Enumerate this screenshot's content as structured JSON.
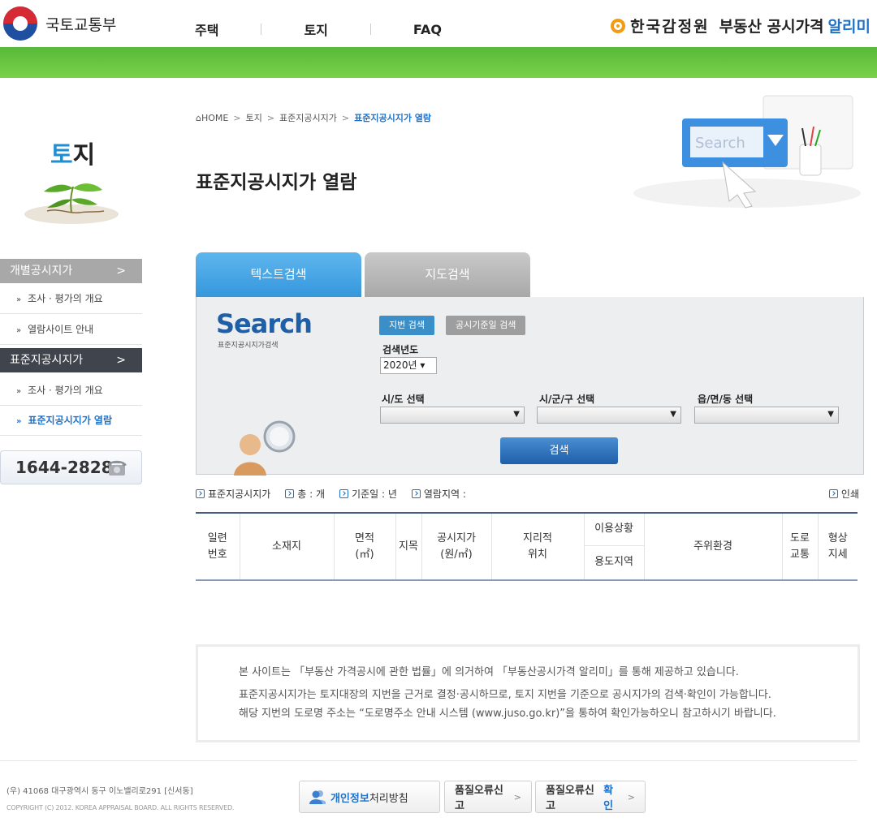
{
  "header": {
    "gov_name": "국토교통부",
    "nav": [
      "주택",
      "토지",
      "FAQ"
    ],
    "kab_name": "한국감정원",
    "service_name": "부동산 공시가격",
    "service_accent": "알리미"
  },
  "sidebar": {
    "title_accent": "토",
    "title_rest": "지",
    "cat1": "개별공시지가",
    "cat1_arrow": ">",
    "cat1_items": [
      "조사 · 평가의 개요",
      "열람사이트 안내"
    ],
    "cat2": "표준지공시지가",
    "cat2_arrow": ">",
    "cat2_items": [
      "조사 · 평가의 개요",
      "표준지공시지가 열람"
    ],
    "bullet": "»",
    "phone": "1644-2828"
  },
  "breadcrumb": {
    "home": "HOME",
    "items": [
      "토지",
      "표준지공시지가"
    ],
    "current": "표준지공시지가 열람",
    "sep": ">"
  },
  "page_title": "표준지공시지가 열람",
  "tabs": [
    "텍스트검색",
    "지도검색"
  ],
  "search": {
    "logo": "Search",
    "logo_sub": "표준지공시지가검색",
    "btn_lot": "지번 검색",
    "btn_date": "공시기준일 검색",
    "year_label": "검색년도",
    "year_value": "2020년 ▾",
    "sido_label": "시/도 선택",
    "sigungu_label": "시/군/구 선택",
    "eupmyeondong_label": "읍/면/동 선택",
    "caret": "▼",
    "submit": "검색"
  },
  "info": {
    "items": [
      "표준지공시지가",
      "총 : 개",
      "기준일 : 년",
      "열람지역 :"
    ],
    "print": "인쇄"
  },
  "table": {
    "col_no": [
      "일련",
      "번호"
    ],
    "col_addr": "소재지",
    "col_area": [
      "면적",
      "(㎡)"
    ],
    "col_jimok": "지목",
    "col_price": [
      "공시지가",
      "(원/㎡)"
    ],
    "col_geo": [
      "지리적",
      "위치"
    ],
    "col_use": "이용상황",
    "col_zone": "용도지역",
    "col_env": "주위환경",
    "col_road": [
      "도로",
      "교통"
    ],
    "col_shape": [
      "형상",
      "지세"
    ]
  },
  "notice": {
    "line1": "본 사이트는 「부동산 가격공시에 관한 법률」에 의거하여 「부동산공시가격 알리미」를 통해 제공하고 있습니다.",
    "line2": "표준지공시지가는 토지대장의 지번을 근거로 결정·공시하므로, 토지 지번을 기준으로 공시지가의 검색·확인이 가능합니다.",
    "line3": "해당 지번의 도로명 주소는 “도로명주소 안내 시스템 (www.juso.go.kr)”을 통하여 확인가능하오니 참고하시기 바랍니다."
  },
  "footer": {
    "address": "(우) 41068  대구광역시 동구 이노밸리로291 [신서동]",
    "copyright": "COPYRIGHT (C) 2012. KOREA APPRAISAL BOARD. ALL RIGHTS RESERVED.",
    "privacy_blue": "개인정보",
    "privacy_rest": "처리방침",
    "error_report": "품질오류신고",
    "error_check_a": "품질오류신고",
    "error_check_b": "확인",
    "chev": ">"
  },
  "colors": {
    "green": "#6cc542",
    "blue": "#1f72c7",
    "tab_active": "#4aa7e6",
    "dark_nav": "#40444c"
  }
}
